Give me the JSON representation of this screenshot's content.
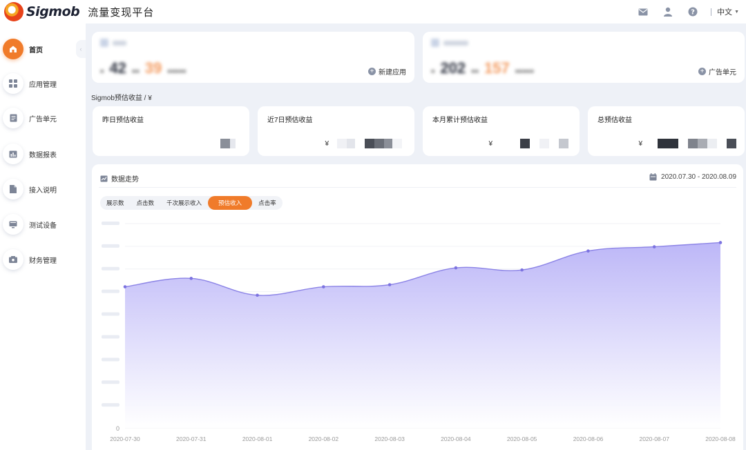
{
  "header": {
    "brand": "Sigmob",
    "title": "流量变现平台",
    "language": "中文"
  },
  "sidebar": {
    "items": [
      {
        "label": "首页",
        "icon": "home-icon",
        "active": true
      },
      {
        "label": "应用管理",
        "icon": "grid-icon"
      },
      {
        "label": "广告单元",
        "icon": "document-icon"
      },
      {
        "label": "数据报表",
        "icon": "bar-chart-icon"
      },
      {
        "label": "接入说明",
        "icon": "file-icon"
      },
      {
        "label": "测试设备",
        "icon": "monitor-icon"
      },
      {
        "label": "财务管理",
        "icon": "wallet-icon"
      }
    ]
  },
  "summary": {
    "apps": {
      "count": "42",
      "secondary": "39",
      "action": "新建应用"
    },
    "ad_units": {
      "count": "202",
      "secondary": "157",
      "action": "广告单元"
    }
  },
  "revenue": {
    "section_label": "Sigmob预估收益 / ¥",
    "currency": "¥",
    "cards": [
      {
        "title": "昨日预估收益"
      },
      {
        "title": "近7日预估收益"
      },
      {
        "title": "本月累计预估收益"
      },
      {
        "title": "总预估收益"
      }
    ]
  },
  "trend": {
    "title": "数据走势",
    "date_range": "2020.07.30 - 2020.08.09",
    "tabs": [
      "展示数",
      "点击数",
      "千次展示收入",
      "预估收入",
      "点击率"
    ],
    "active_tab": "预估收入"
  },
  "colors": {
    "accent": "#f07b2a",
    "line": "#8b83e6",
    "fill_top": "#b9b3f7"
  },
  "chart_data": {
    "type": "area",
    "x": [
      "2020-07-30",
      "2020-07-31",
      "2020-08-01",
      "2020-08-02",
      "2020-08-03",
      "2020-08-04",
      "2020-08-05",
      "2020-08-06",
      "2020-08-07",
      "2020-08-08"
    ],
    "values": [
      67,
      71,
      63,
      67,
      68,
      76,
      75,
      84,
      86,
      88
    ],
    "ylim": [
      0,
      97
    ],
    "y_tick_labels": [
      "0"
    ],
    "grid": true,
    "legend": "none"
  }
}
